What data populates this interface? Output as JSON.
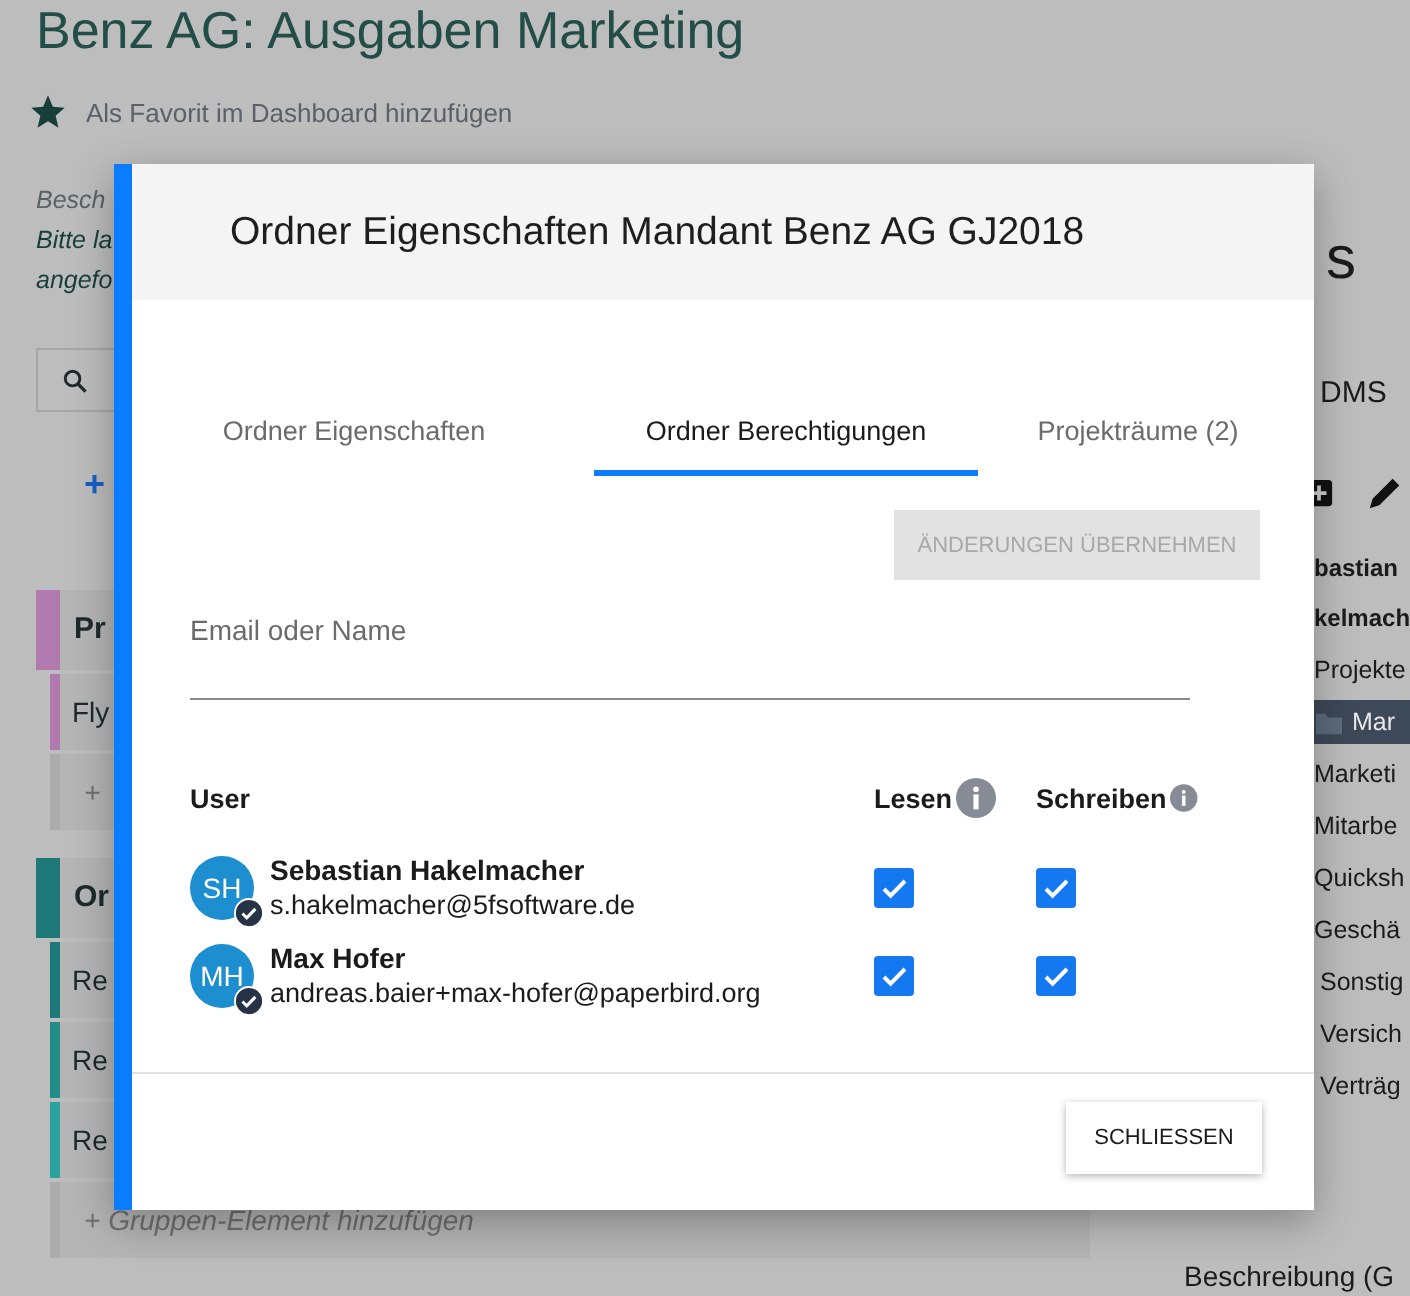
{
  "page": {
    "title": "Benz AG: Ausgaben Marketing",
    "favorite": "Als Favorit im Dashboard hinzufügen",
    "description_lines": [
      "Besch",
      "Bitte la",
      "angefo"
    ],
    "add_label": "+",
    "groups": [
      {
        "label": "Pr",
        "color": "#b07aae",
        "items": [
          {
            "label": "Fly",
            "color": "#b07aae"
          }
        ],
        "add_label": "+"
      },
      {
        "label": "Or",
        "color": "#1e7a78",
        "items": [
          {
            "label": "Re",
            "color": "#1e7a78"
          },
          {
            "label": "Re",
            "color": "#228c89"
          },
          {
            "label": "Re",
            "color": "#2aa29e"
          }
        ],
        "add_label": "+ Gruppen-Element hinzufügen"
      }
    ]
  },
  "right_panel": {
    "heading": "s",
    "subheading": "DMS",
    "owner_lines": [
      "bastian",
      "kelmach"
    ],
    "tree": [
      {
        "label": "Projekte",
        "selected": false,
        "kind": "plain"
      },
      {
        "label": "Mar",
        "selected": true,
        "kind": "folder"
      },
      {
        "label": "Marketi",
        "selected": false,
        "kind": "plain"
      },
      {
        "label": "Mitarbe",
        "selected": false,
        "kind": "plain"
      },
      {
        "label": "Quicksh",
        "selected": false,
        "kind": "plain"
      },
      {
        "label": "Geschä",
        "selected": false,
        "kind": "plain"
      },
      {
        "label": "Sonstig",
        "selected": false,
        "kind": "plain"
      },
      {
        "label": "Versich",
        "selected": false,
        "kind": "plain"
      },
      {
        "label": "Verträg",
        "selected": false,
        "kind": "plain"
      }
    ],
    "description_label": "Beschreibung (G"
  },
  "dialog": {
    "title": "Ordner Eigenschaften Mandant Benz AG GJ2018",
    "tabs": [
      {
        "label": "Ordner Eigenschaften",
        "selected": false
      },
      {
        "label": "Ordner Berechtigungen",
        "selected": true
      },
      {
        "label": "Projekträume (2)",
        "selected": false
      }
    ],
    "apply_button": {
      "label": "ÄNDERUNGEN ÜBERNEHMEN",
      "disabled": true
    },
    "search": {
      "placeholder": "Email oder Name"
    },
    "columns": {
      "user": "User",
      "read": "Lesen",
      "write": "Schreiben"
    },
    "users": [
      {
        "initials": "SH",
        "name": "Sebastian Hakelmacher",
        "email": "s.hakelmacher@5fsoftware.de",
        "verified": true,
        "read": true,
        "write": true
      },
      {
        "initials": "MH",
        "name": "Max Hofer",
        "email": "andreas.baier+max-hofer@paperbird.org",
        "verified": true,
        "read": true,
        "write": true
      }
    ],
    "close_button": "SCHLIESSEN"
  }
}
